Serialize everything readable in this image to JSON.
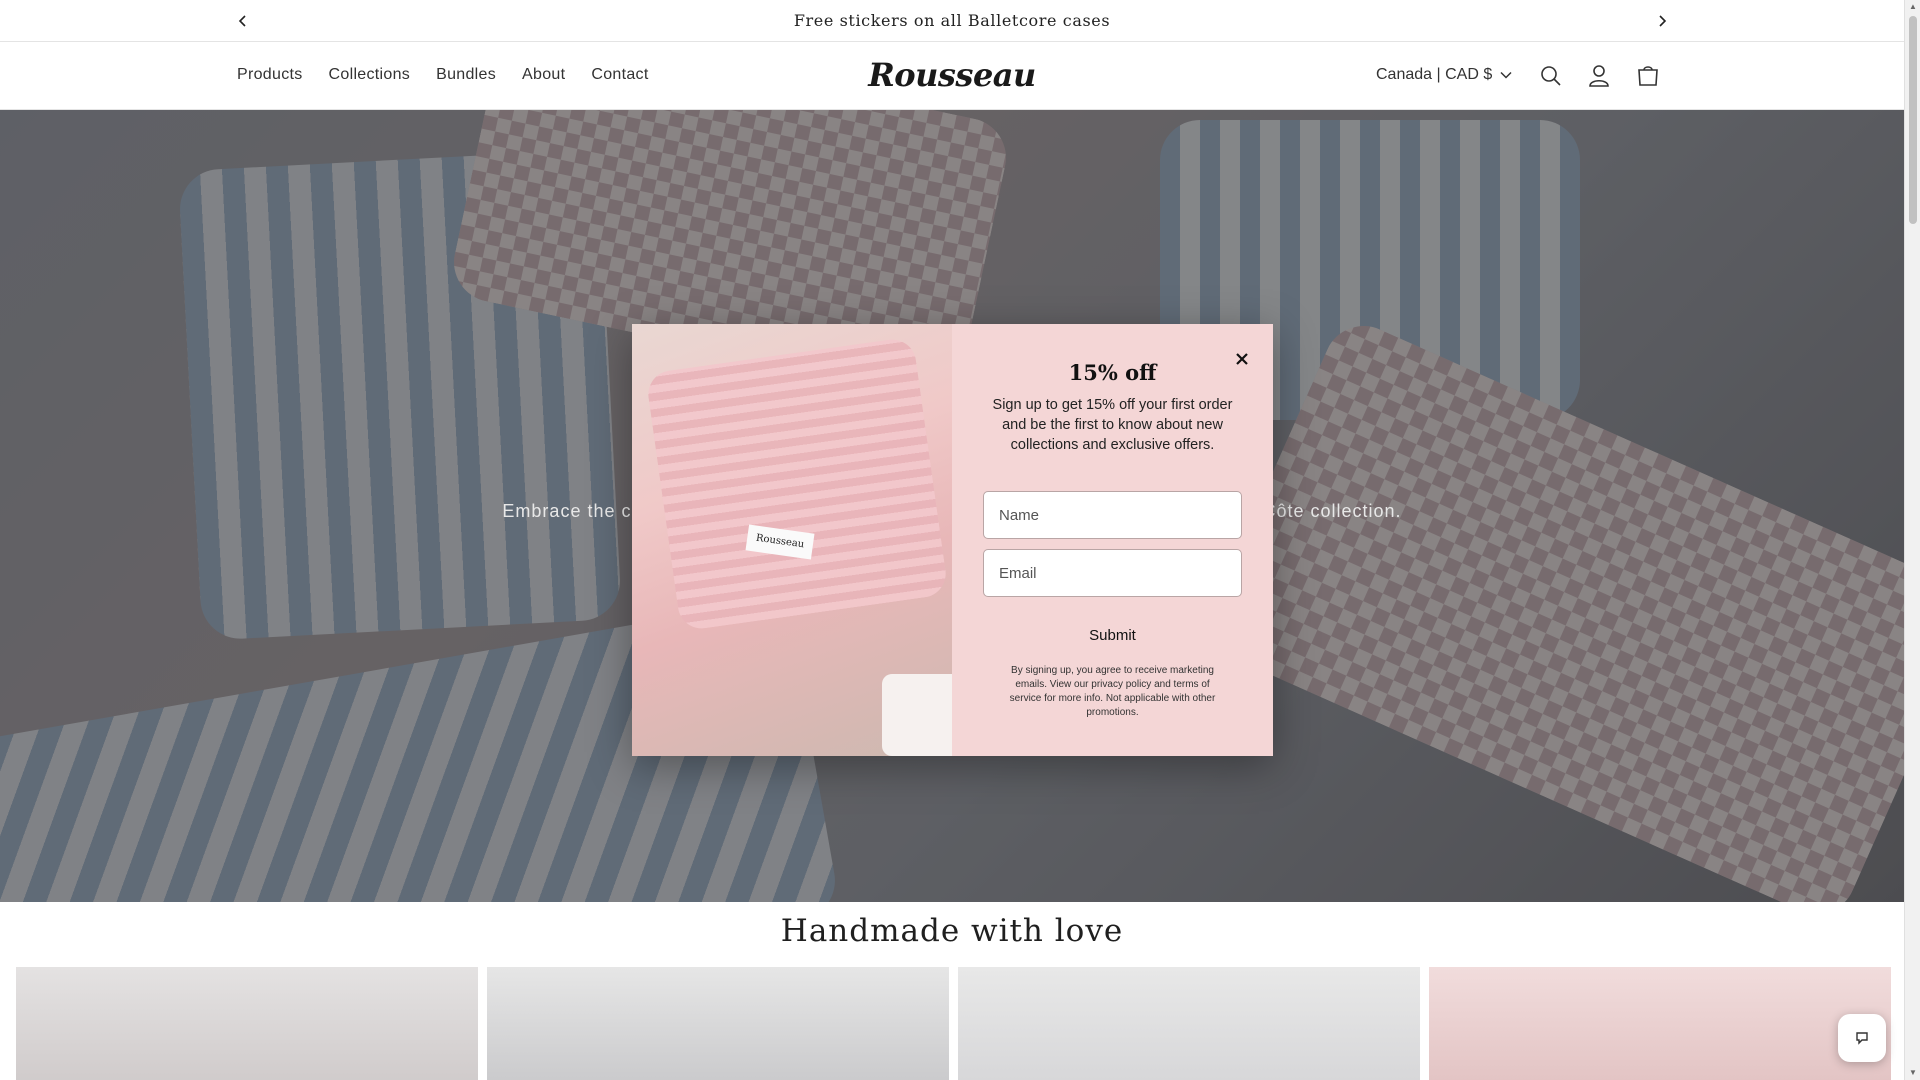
{
  "announcement": {
    "text": "Free stickers on all Balletcore cases",
    "prev_icon": "chevron-left-icon",
    "next_icon": "chevron-right-icon"
  },
  "header": {
    "nav": [
      {
        "label": "Products"
      },
      {
        "label": "Collections"
      },
      {
        "label": "Bundles"
      },
      {
        "label": "About"
      },
      {
        "label": "Contact"
      }
    ],
    "logo": "Rousseau",
    "country": "Canada | CAD $",
    "icons": [
      "search-icon",
      "account-icon",
      "cart-icon"
    ]
  },
  "hero": {
    "subtitle_left": "Embrace the ch",
    "subtitle_right": "Côte collection."
  },
  "section": {
    "title": "Handmade with love"
  },
  "modal": {
    "title": "15% off",
    "description": "Sign up to get 15% off your first order and be the first to know about new collections and exclusive offers.",
    "name_placeholder": "Name",
    "email_placeholder": "Email",
    "submit_label": "Submit",
    "fine_print": "By signing up, you agree to receive marketing emails. View our privacy policy and terms of service for more info. Not applicable with other promotions.",
    "photo_label": "Rousseau"
  },
  "colors": {
    "modal_form_bg": "#f4d6d6",
    "accent": "#1a1a1a"
  }
}
